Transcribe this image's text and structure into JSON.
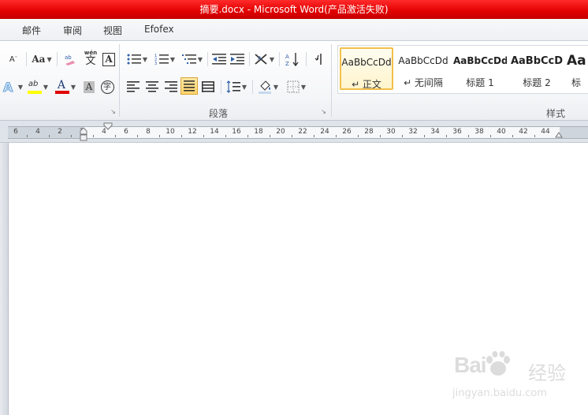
{
  "window": {
    "title": "摘要.docx - Microsoft Word(产品激活失败)"
  },
  "tabs": [
    "邮件",
    "审阅",
    "视图",
    "Efofex"
  ],
  "ribbon": {
    "font_group": {
      "case_label": "Aa",
      "shrink_label": "A",
      "highlight_label": "ab",
      "char_border_label": "A",
      "phonetic_label": "wén",
      "phonetic_char": "文",
      "enclose_char": "字"
    },
    "paragraph_group": {
      "label": "段落"
    },
    "styles_group": {
      "label": "样式",
      "items": [
        {
          "sample": "AaBbCcDd",
          "name": "↵ 正文",
          "active": true
        },
        {
          "sample": "AaBbCcDd",
          "name": "↵ 无间隔",
          "active": false
        },
        {
          "sample": "AaBbCcDd",
          "name": "标题 1",
          "active": false
        },
        {
          "sample": "AaBbCcD",
          "name": "标题 2",
          "active": false
        },
        {
          "sample": "Aa",
          "name": "标",
          "active": false
        }
      ]
    }
  },
  "ruler": {
    "labels": [
      "6",
      "4",
      "2",
      "2",
      "4",
      "6",
      "8",
      "10",
      "12",
      "14",
      "16",
      "18",
      "20",
      "22",
      "24",
      "26",
      "28",
      "30",
      "32",
      "34",
      "36",
      "38",
      "40",
      "42",
      "44"
    ]
  },
  "watermark": {
    "brand": "Bai",
    "brand_cn": "经验",
    "url": "jingyan.baidu.com"
  },
  "colors": {
    "titlebar": "#e10000",
    "highlight": "#ffff00",
    "font_color": "#e00000",
    "active_style": "#f2c04b"
  }
}
